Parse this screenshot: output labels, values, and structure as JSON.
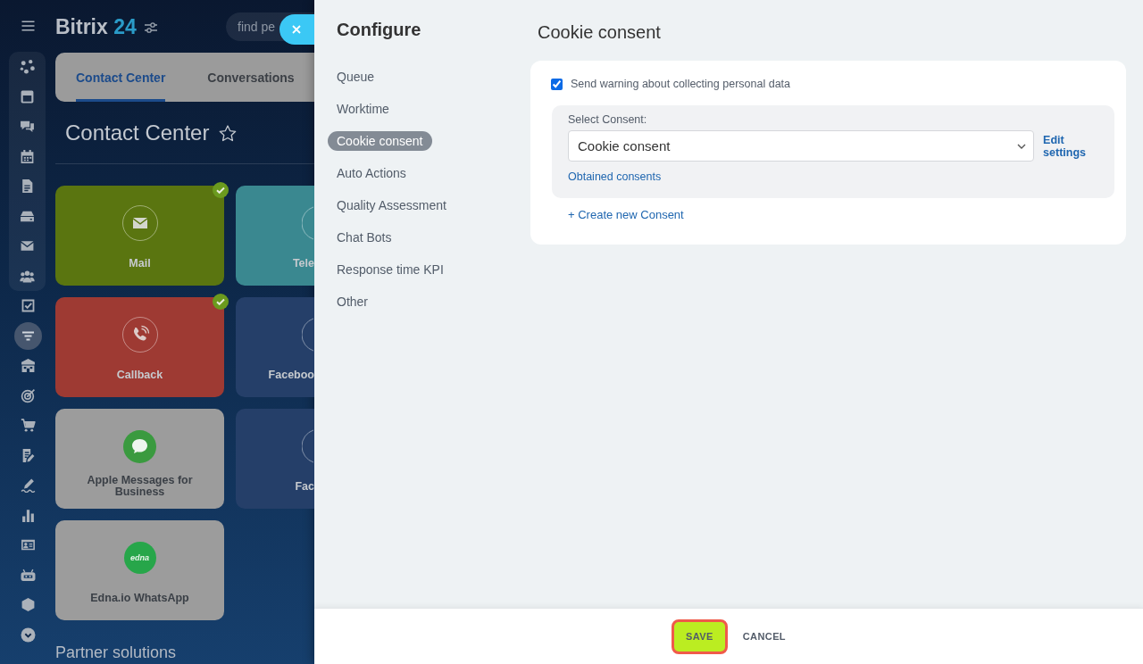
{
  "nav_rail": {
    "group": [
      {
        "selected": false
      },
      {
        "selected": false
      },
      {
        "selected": false
      },
      {
        "selected": false
      },
      {
        "selected": false
      },
      {
        "selected": false
      },
      {
        "selected": false
      },
      {
        "selected": false
      }
    ],
    "items": [
      {
        "selected": false
      },
      {
        "selected": true
      },
      {
        "selected": false
      },
      {
        "selected": false
      },
      {
        "selected": false
      },
      {
        "selected": false
      },
      {
        "selected": false
      },
      {
        "selected": false
      },
      {
        "selected": false
      },
      {
        "selected": false
      },
      {
        "selected": false
      },
      {
        "selected": false
      }
    ]
  },
  "header": {
    "logo": {
      "name": "Bitrix",
      "number": "24"
    },
    "search": {
      "placeholder": "find pe"
    }
  },
  "tabs": [
    {
      "label": "Contact Center",
      "selected": true
    },
    {
      "label": "Conversations",
      "selected": false
    }
  ],
  "page_title": {
    "text": "Contact Center",
    "favorite": false
  },
  "tiles": [
    {
      "label": "Mail",
      "kind": "ring",
      "color": "#5a7510",
      "connected": true
    },
    {
      "label": "Tele",
      "kind": "ring",
      "color": "#3a8890",
      "connected": false
    },
    {
      "label": "Callback",
      "kind": "ring",
      "color": "#9e3a33",
      "connected": true
    },
    {
      "label": "Faceboo",
      "kind": "ring",
      "color": "#253f69",
      "connected": false
    },
    {
      "label": "Apple Messages for Business",
      "kind": "disc",
      "color": "#9c9c9c",
      "connected": false
    },
    {
      "label": "Fac",
      "kind": "ring",
      "color": "#253f69",
      "connected": false
    },
    {
      "label": "Edna.io WhatsApp",
      "kind": "disc",
      "color": "#9c9c9c",
      "connected": false,
      "logo_text": "edna"
    }
  ],
  "section_heading": "Partner solutions",
  "configure": {
    "title": "Configure",
    "items": [
      {
        "label": "Queue",
        "selected": false
      },
      {
        "label": "Worktime",
        "selected": false
      },
      {
        "label": "Cookie consent",
        "selected": true
      },
      {
        "label": "Auto Actions",
        "selected": false
      },
      {
        "label": "Quality Assessment",
        "selected": false
      },
      {
        "label": "Chat Bots",
        "selected": false
      },
      {
        "label": "Response time KPI",
        "selected": false
      },
      {
        "label": "Other",
        "selected": false
      }
    ]
  },
  "settings": {
    "title": "Cookie consent",
    "warning": {
      "label": "Send warning about collecting personal data",
      "checked": true
    },
    "consent": {
      "label": "Select Consent:",
      "value": "Cookie consent",
      "edit_link": "Edit settings",
      "obtained_link": "Obtained consents"
    },
    "create_link": "+ Create new Consent"
  },
  "footer": {
    "buttons": [
      {
        "label": "SAVE",
        "kind": "primary",
        "highlighted": true
      },
      {
        "label": "CANCEL",
        "kind": "plain",
        "highlighted": false
      }
    ]
  }
}
